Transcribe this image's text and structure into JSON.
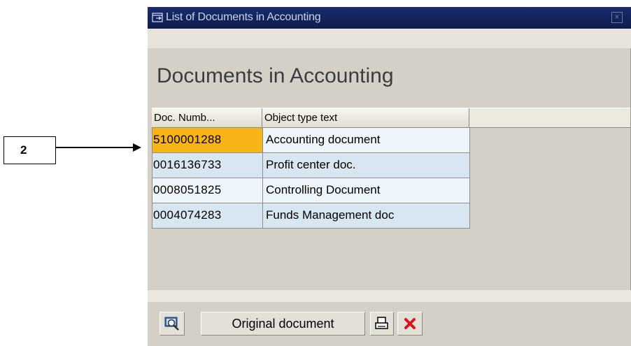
{
  "callout": {
    "label": "2"
  },
  "window": {
    "title": "List of Documents in Accounting",
    "close_glyph": "×",
    "heading": "Documents in Accounting"
  },
  "table": {
    "columns": [
      "Doc. Numb...",
      "Object type text"
    ],
    "rows": [
      {
        "doc_number": "5100001288",
        "object_type": "Accounting document",
        "selected": true
      },
      {
        "doc_number": "0016136733",
        "object_type": "Profit center doc.",
        "selected": false
      },
      {
        "doc_number": "0008051825",
        "object_type": "Controlling Document",
        "selected": false
      },
      {
        "doc_number": "0004074283",
        "object_type": "Funds Management doc",
        "selected": false
      }
    ]
  },
  "footer": {
    "original_document_label": "Original document",
    "icons": [
      "display-details-icon",
      "print-icon",
      "cancel-icon"
    ]
  },
  "colors": {
    "titlebar": "#192c6b",
    "selected_cell": "#f7b417",
    "row_light": "#eef5fb",
    "row_dark": "#d8e6f1",
    "cancel_red": "#d8141b"
  }
}
